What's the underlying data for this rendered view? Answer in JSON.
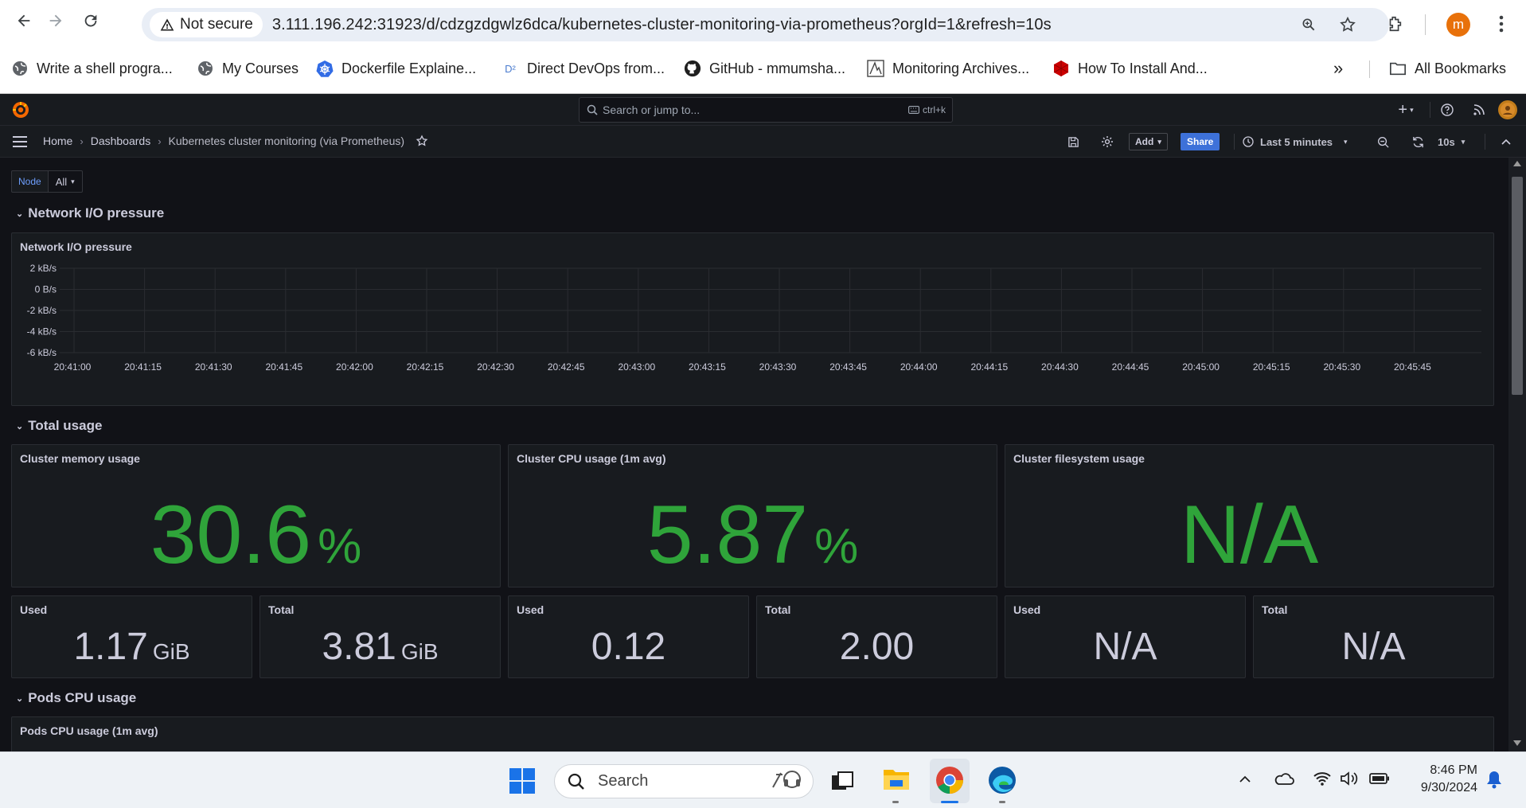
{
  "browser": {
    "security_label": "Not secure",
    "url": "3.111.196.242:31923/d/cdzgzdgwlz6dca/kubernetes-cluster-monitoring-via-prometheus?orgId=1&refresh=10s",
    "profile_initial": "m",
    "bookmarks": [
      {
        "label": "Write a shell progra...",
        "icon": "globe-icon"
      },
      {
        "label": "My Courses",
        "icon": "globe-icon"
      },
      {
        "label": "Dockerfile Explaine...",
        "icon": "kubernetes-icon"
      },
      {
        "label": "Direct DevOps from...",
        "icon": "d2-icon"
      },
      {
        "label": "GitHub - mmumsha...",
        "icon": "github-icon"
      },
      {
        "label": "Monitoring Archives...",
        "icon": "monitoring-icon"
      },
      {
        "label": "How To Install And...",
        "icon": "redhat-icon"
      }
    ],
    "all_bookmarks": "All Bookmarks"
  },
  "grafana": {
    "search_placeholder": "Search or jump to...",
    "search_shortcut": "ctrl+k",
    "breadcrumb": [
      "Home",
      "Dashboards",
      "Kubernetes cluster monitoring (via Prometheus)"
    ],
    "add_label": "Add",
    "share_label": "Share",
    "time_range": "Last 5 minutes",
    "refresh_interval": "10s",
    "variable": {
      "label": "Node",
      "value": "All"
    }
  },
  "rows": {
    "network": "Network I/O pressure",
    "total": "Total usage",
    "pods": "Pods CPU usage"
  },
  "panels": {
    "network": {
      "title": "Network I/O pressure"
    },
    "memory": {
      "title": "Cluster memory usage",
      "value": "30.6",
      "unit": "%"
    },
    "cpu": {
      "title": "Cluster CPU usage (1m avg)",
      "value": "5.87",
      "unit": "%"
    },
    "fs": {
      "title": "Cluster filesystem usage",
      "value": "N/A",
      "unit": ""
    },
    "mem_used": {
      "title": "Used",
      "value": "1.17",
      "unit": "GiB"
    },
    "mem_total": {
      "title": "Total",
      "value": "3.81",
      "unit": "GiB"
    },
    "cpu_used": {
      "title": "Used",
      "value": "0.12",
      "unit": ""
    },
    "cpu_total": {
      "title": "Total",
      "value": "2.00",
      "unit": ""
    },
    "fs_used": {
      "title": "Used",
      "value": "N/A",
      "unit": ""
    },
    "fs_total": {
      "title": "Total",
      "value": "N/A",
      "unit": ""
    },
    "pods": {
      "title": "Pods CPU usage (1m avg)"
    }
  },
  "chart_data": {
    "type": "line",
    "title": "Network I/O pressure",
    "y_ticks": [
      "2 kB/s",
      "0 B/s",
      "-2 kB/s",
      "-4 kB/s",
      "-6 kB/s"
    ],
    "ylim": [
      -6,
      2
    ],
    "ylabel_unit": "kB/s",
    "x_ticks": [
      "20:41:00",
      "20:41:15",
      "20:41:30",
      "20:41:45",
      "20:42:00",
      "20:42:15",
      "20:42:30",
      "20:42:45",
      "20:43:00",
      "20:43:15",
      "20:43:30",
      "20:43:45",
      "20:44:00",
      "20:44:15",
      "20:44:30",
      "20:44:45",
      "20:45:00",
      "20:45:15",
      "20:45:30",
      "20:45:45"
    ],
    "series": [],
    "grid": true
  },
  "taskbar": {
    "search_label": "Search",
    "time": "8:46 PM",
    "date": "9/30/2024"
  },
  "colors": {
    "accent_green": "#2fa43a",
    "share_blue": "#3d71d9",
    "panel_bg": "#181b1f"
  }
}
